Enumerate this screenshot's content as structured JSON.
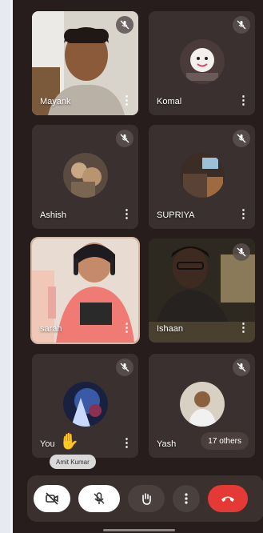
{
  "participants": [
    {
      "name": "Mayank"
    },
    {
      "name": "Komal"
    },
    {
      "name": "Ashish"
    },
    {
      "name": "SUPRIYA"
    },
    {
      "name": "sarah"
    },
    {
      "name": "Ishaan"
    },
    {
      "name": "You"
    },
    {
      "name": "Yash"
    }
  ],
  "others_label": "17 others",
  "raised_hand_tooltip": "Amit Kumar",
  "toolbar": {
    "icons": [
      "camera-off-icon",
      "mic-off-icon",
      "raise-hand-icon",
      "more-vert-icon",
      "end-call-icon"
    ]
  },
  "colors": {
    "background": "#261d1c",
    "tile": "#3a302f",
    "end_call": "#e53935",
    "active_border": "#d7b5a4"
  }
}
